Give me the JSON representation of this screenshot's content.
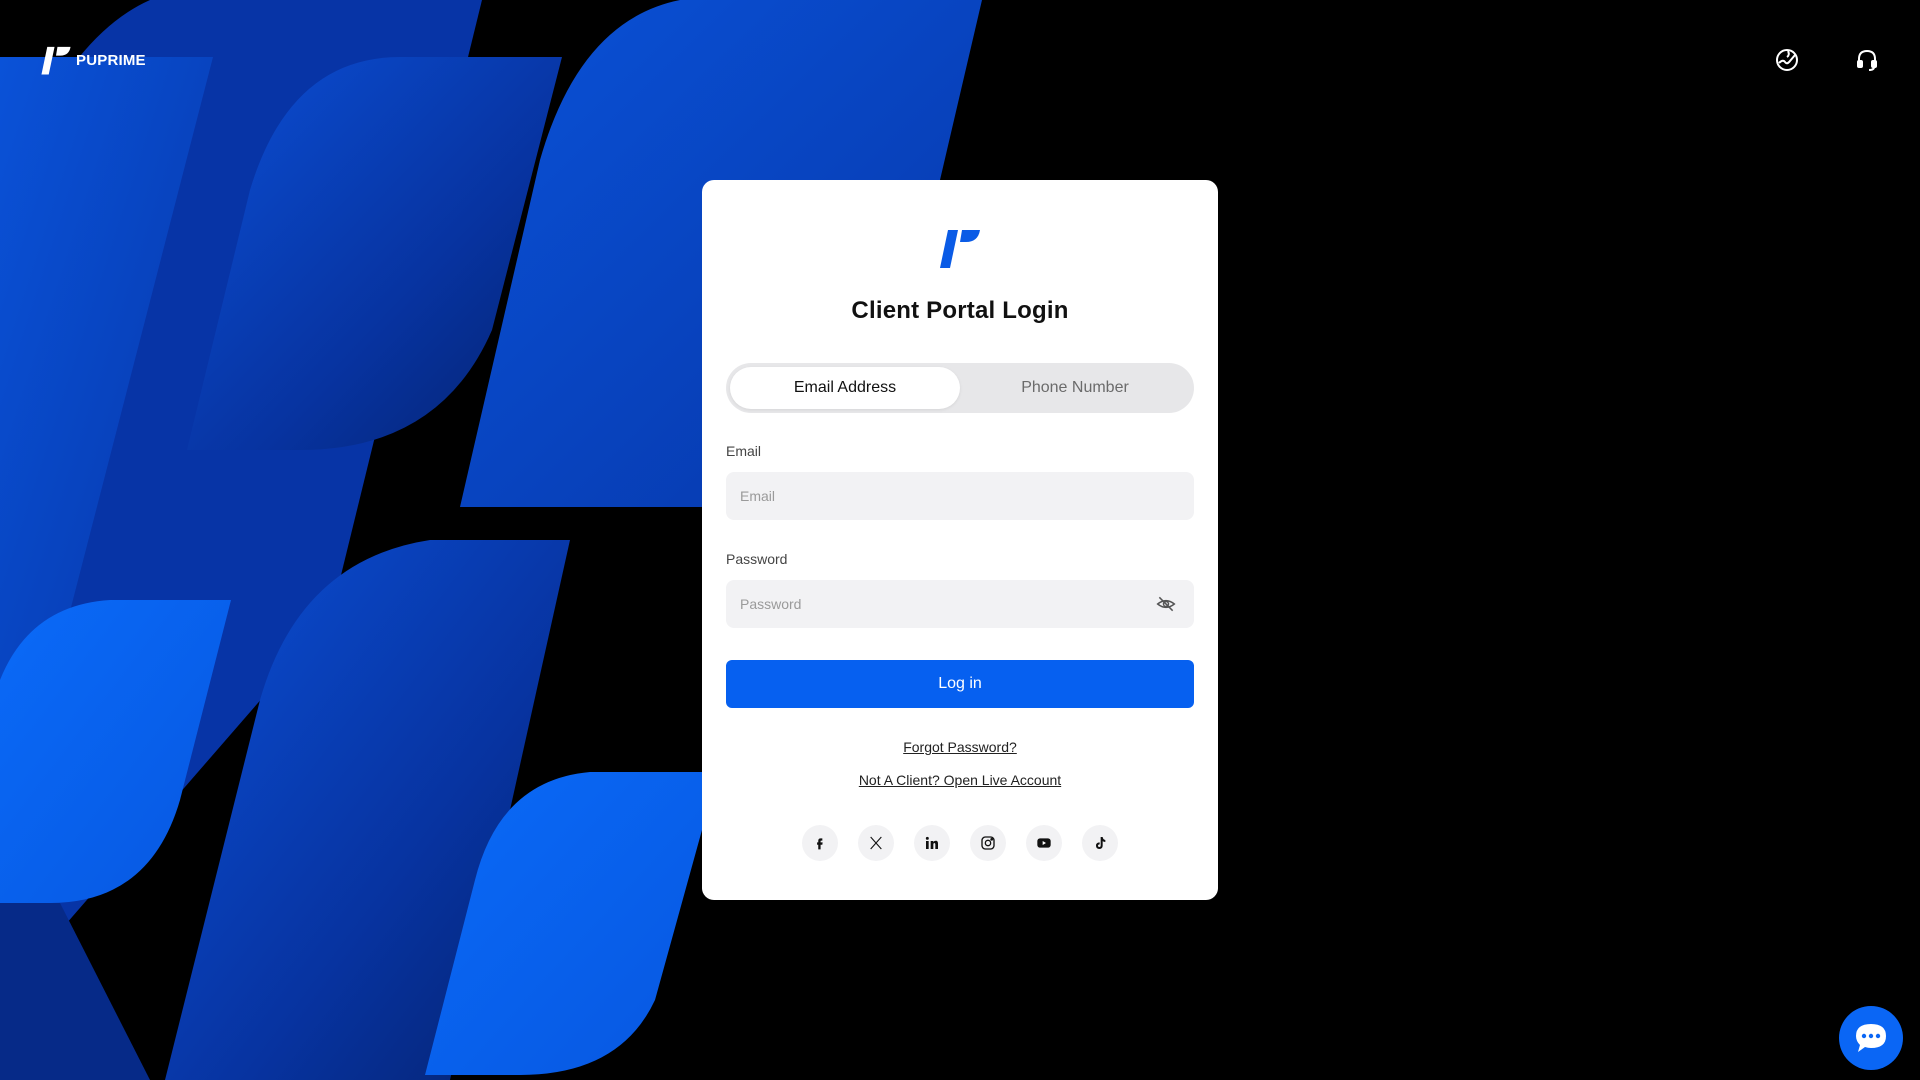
{
  "brand": {
    "name": "PUPRIME",
    "logo_icon": "puprime-logo-icon"
  },
  "header": {
    "language_icon": "globe-icon",
    "support_icon": "headset-icon"
  },
  "login": {
    "title": "Client Portal Login",
    "tabs": [
      {
        "label": "Email Address",
        "active": true
      },
      {
        "label": "Phone Number",
        "active": false
      }
    ],
    "email": {
      "label": "Email",
      "placeholder": "Email",
      "value": ""
    },
    "password": {
      "label": "Password",
      "placeholder": "Password",
      "value": "",
      "toggle_icon": "eye-off-icon"
    },
    "submit_label": "Log in",
    "forgot_password": "Forgot Password?",
    "open_account": "Not A Client? Open Live Account"
  },
  "socials": [
    {
      "name": "facebook-icon"
    },
    {
      "name": "x-icon"
    },
    {
      "name": "linkedin-icon"
    },
    {
      "name": "instagram-icon"
    },
    {
      "name": "youtube-icon"
    },
    {
      "name": "tiktok-icon"
    }
  ],
  "chat": {
    "icon": "chat-bubble-icon"
  },
  "colors": {
    "primary": "#0660f0",
    "background": "#000000",
    "card": "#ffffff",
    "shape_dark": "#0a3db5",
    "shape_bright": "#0a66f5"
  }
}
